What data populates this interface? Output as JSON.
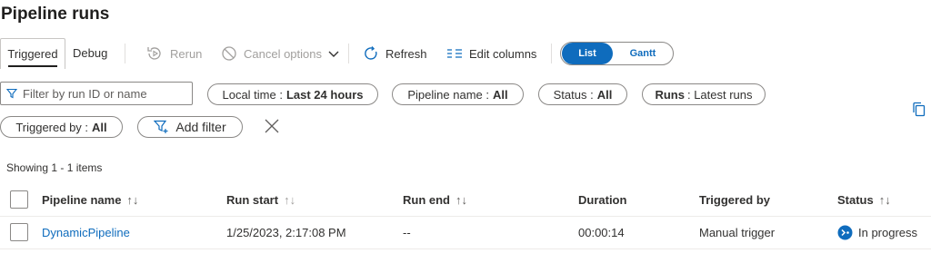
{
  "page": {
    "title": "Pipeline runs"
  },
  "tabs": [
    {
      "label": "Triggered",
      "active": true
    },
    {
      "label": "Debug",
      "active": false
    }
  ],
  "toolbar": {
    "rerun_label": "Rerun",
    "cancel_label": "Cancel options",
    "refresh_label": "Refresh",
    "edit_columns_label": "Edit columns"
  },
  "view_toggle": {
    "list_label": "List",
    "gantt_label": "Gantt",
    "selected": "List"
  },
  "filters": {
    "search_placeholder": "Filter by run ID or name",
    "local_time": {
      "label": "Local time :",
      "value": "Last 24 hours"
    },
    "pipeline_name": {
      "label": "Pipeline name :",
      "value": "All"
    },
    "status": {
      "label": "Status :",
      "value": "All"
    },
    "runs": {
      "label": "Runs",
      "value": ": Latest runs"
    },
    "triggered_by": {
      "label": "Triggered by :",
      "value": "All"
    },
    "add_filter_label": "Add filter"
  },
  "showing_text": "Showing 1 - 1 items",
  "table": {
    "columns": [
      "Pipeline name",
      "Run start",
      "Run end",
      "Duration",
      "Triggered by",
      "Status"
    ],
    "rows": [
      {
        "pipeline_name": "DynamicPipeline",
        "run_start": "1/25/2023, 2:17:08 PM",
        "run_end": "--",
        "duration": "00:00:14",
        "triggered_by": "Manual trigger",
        "status": "In progress"
      }
    ]
  },
  "colors": {
    "accent": "#0f6cbd",
    "text": "#323130",
    "disabled": "#a19f9d"
  },
  "icons": [
    "rerun-icon",
    "cancel-icon",
    "chevron-down-icon",
    "refresh-icon",
    "edit-columns-icon",
    "filter-icon",
    "add-filter-icon",
    "close-icon",
    "copy-icon",
    "sort-icon",
    "in-progress-icon"
  ]
}
